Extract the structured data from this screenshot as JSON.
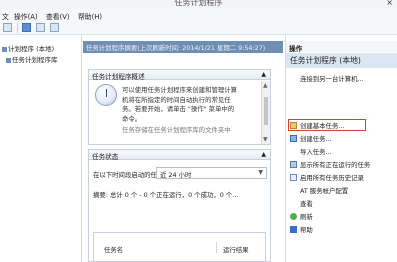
{
  "window": {
    "title": "任务计划程序",
    "close_glyph": "×"
  },
  "menu": {
    "items": [
      "操作(A)",
      "查看(V)",
      "帮助(H)"
    ]
  },
  "tree": {
    "items": [
      "计划程序 (本地)",
      "任务计划程序库"
    ]
  },
  "center": {
    "header": "任务计划程序摘要(上次刷新时间: 2014/1/21 星期二 9:54:27)",
    "overview": {
      "title": "任务计划程序概述",
      "description": "可以使用任务计划程序来创建和管理计算机将在所指定的时间自动执行的常见任务。若要开始，请单击 \"操作\" 菜单中的命令。",
      "description_cont": "任务存储在任务计划程序库的文件夹中"
    },
    "status": {
      "title": "任务状态",
      "filter_label": "在以下时间段启动的任...",
      "filter_value": "近 24 小时",
      "summary": "摘要: 总计 0 个 - 0 个正在运行，0 个成功，0 个...",
      "col_task_name": "任务名",
      "col_run_result": "运行结果"
    }
  },
  "actions": {
    "header": "操作",
    "section_title": "任务计划程序 (本地)",
    "items": [
      {
        "label": "连接到另一台计算机..."
      },
      {
        "label": "创建基本任务..."
      },
      {
        "label": "创建任务..."
      },
      {
        "label": "导入任务..."
      },
      {
        "label": "显示所有正在运行的任务"
      },
      {
        "label": "启用所有任务历史记录"
      },
      {
        "label": "AT 服务帐户配置"
      },
      {
        "label": "查看"
      },
      {
        "label": "刷新"
      },
      {
        "label": "帮助"
      }
    ]
  },
  "icons": {
    "connect": "computer-connect-icon",
    "basic_task": "create-basic-task-icon",
    "task": "create-task-icon",
    "running": "running-tasks-icon",
    "history": "history-icon",
    "refresh": "refresh-icon",
    "help": "help-icon"
  },
  "colors": {
    "header_blue": "#6f8eb5",
    "action_section": "#dbe6f3",
    "highlight": "#e53935"
  }
}
